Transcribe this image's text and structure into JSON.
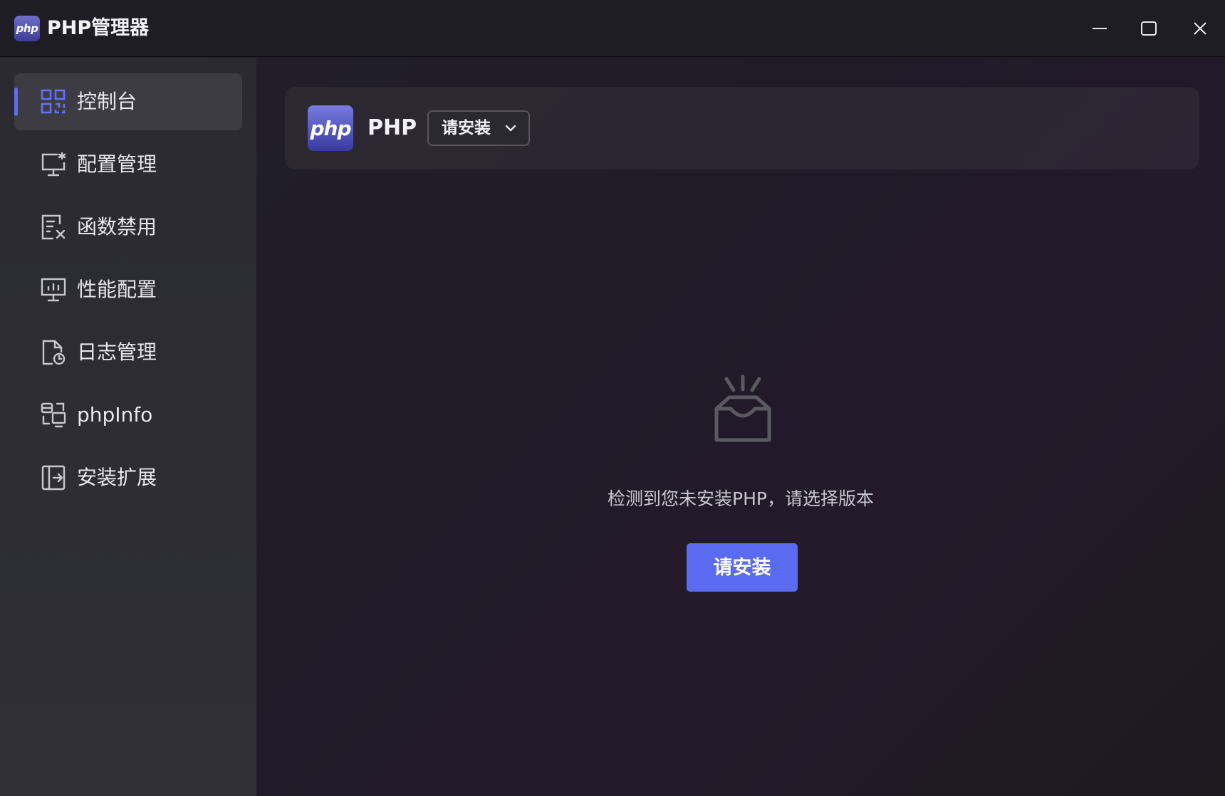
{
  "window": {
    "title": "PHP管理器",
    "logo_text": "php",
    "controls": [
      "minimize-icon",
      "maximize-icon",
      "close-icon"
    ]
  },
  "sidebar": {
    "items": [
      {
        "label": "控制台",
        "icon": "dashboard-grid-icon",
        "active": true
      },
      {
        "label": "配置管理",
        "icon": "monitor-settings-icon",
        "active": false
      },
      {
        "label": "函数禁用",
        "icon": "document-disable-icon",
        "active": false
      },
      {
        "label": "性能配置",
        "icon": "monitor-chart-icon",
        "active": false
      },
      {
        "label": "日志管理",
        "icon": "document-clock-icon",
        "active": false
      },
      {
        "label": "phpInfo",
        "icon": "info-devices-icon",
        "active": false
      },
      {
        "label": "安装扩展",
        "icon": "extension-export-icon",
        "active": false
      }
    ],
    "collapse_icon": "menu-collapse-icon"
  },
  "header": {
    "logo_text": "php",
    "label": "PHP",
    "version_select": {
      "value": "请安装",
      "icon": "chevron-down-icon"
    }
  },
  "empty_state": {
    "icon": "empty-inbox-icon",
    "message": "检测到您未安装PHP，请选择版本",
    "button_label": "请安装"
  },
  "colors": {
    "accent": "#5a6af1",
    "sidebar_bg": "#2d2c33",
    "active_item_bg": "#3d3c45"
  }
}
